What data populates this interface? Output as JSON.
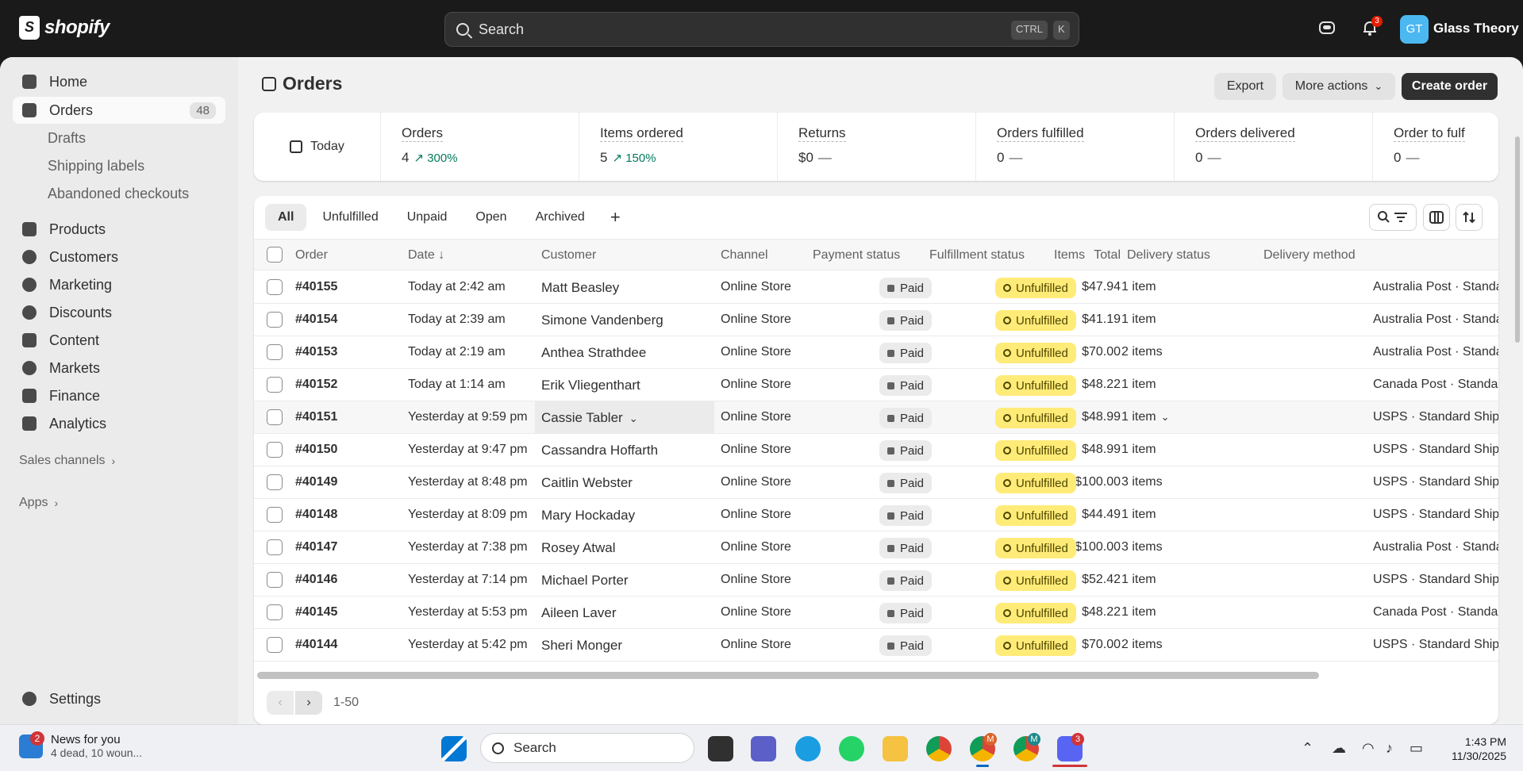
{
  "topbar": {
    "brand": "shopify",
    "search_placeholder": "Search",
    "shortcut_ctrl": "CTRL",
    "shortcut_k": "K",
    "notification_count": "3",
    "avatar_initials": "GT",
    "store_name": "Glass Theory"
  },
  "sidebar": {
    "home": "Home",
    "orders": "Orders",
    "orders_count": "48",
    "drafts": "Drafts",
    "shipping_labels": "Shipping labels",
    "abandoned_checkouts": "Abandoned checkouts",
    "products": "Products",
    "customers": "Customers",
    "marketing": "Marketing",
    "discounts": "Discounts",
    "content": "Content",
    "markets": "Markets",
    "finance": "Finance",
    "analytics": "Analytics",
    "sales_channels": "Sales channels",
    "apps": "Apps",
    "settings": "Settings"
  },
  "header": {
    "title": "Orders",
    "export": "Export",
    "more_actions": "More actions",
    "create_order": "Create order"
  },
  "metrics": {
    "date": "Today",
    "items": [
      {
        "label": "Orders",
        "value": "4",
        "trend": "300%"
      },
      {
        "label": "Items ordered",
        "value": "5",
        "trend": "150%"
      },
      {
        "label": "Returns",
        "value": "$0",
        "trend": "—"
      },
      {
        "label": "Orders fulfilled",
        "value": "0",
        "trend": "—"
      },
      {
        "label": "Orders delivered",
        "value": "0",
        "trend": "—"
      },
      {
        "label": "Order to fulf",
        "value": "0",
        "trend": "—"
      }
    ]
  },
  "tabs": [
    "All",
    "Unfulfilled",
    "Unpaid",
    "Open",
    "Archived",
    "+"
  ],
  "columns": [
    "Order",
    "Date ↓",
    "Customer",
    "Channel",
    "Total",
    "Payment status",
    "Fulfillment status",
    "Items",
    "Delivery status",
    "Delivery method"
  ],
  "rows": [
    {
      "order": "#40155",
      "date": "Today at 2:42 am",
      "customer": "Matt Beasley",
      "channel": "Online Store",
      "total": "$47.94",
      "payment": "Paid",
      "fulfillment": "Unfulfilled",
      "items": "1 item",
      "delivery_method": "Australia Post · Standard Shi..."
    },
    {
      "order": "#40154",
      "date": "Today at 2:39 am",
      "customer": "Simone Vandenberg",
      "channel": "Online Store",
      "total": "$41.19",
      "payment": "Paid",
      "fulfillment": "Unfulfilled",
      "items": "1 item",
      "delivery_method": "Australia Post · Standard Shi..."
    },
    {
      "order": "#40153",
      "date": "Today at 2:19 am",
      "customer": "Anthea Strathdee",
      "channel": "Online Store",
      "total": "$70.00",
      "payment": "Paid",
      "fulfillment": "Unfulfilled",
      "items": "2 items",
      "delivery_method": "Australia Post · Standard Shi..."
    },
    {
      "order": "#40152",
      "date": "Today at 1:14 am",
      "customer": "Erik Vliegenthart",
      "channel": "Online Store",
      "total": "$48.22",
      "payment": "Paid",
      "fulfillment": "Unfulfilled",
      "items": "1 item",
      "delivery_method": "Canada Post · Standard Shipp"
    },
    {
      "order": "#40151",
      "date": "Yesterday at 9:59 pm",
      "customer": "Cassie Tabler",
      "channel": "Online Store",
      "total": "$48.99",
      "payment": "Paid",
      "fulfillment": "Unfulfilled",
      "items": "1 item",
      "delivery_method": "USPS · Standard Shipping"
    },
    {
      "order": "#40150",
      "date": "Yesterday at 9:47 pm",
      "customer": "Cassandra Hoffarth",
      "channel": "Online Store",
      "total": "$48.99",
      "payment": "Paid",
      "fulfillment": "Unfulfilled",
      "items": "1 item",
      "delivery_method": "USPS · Standard Shipping"
    },
    {
      "order": "#40149",
      "date": "Yesterday at 8:48 pm",
      "customer": "Caitlin Webster",
      "channel": "Online Store",
      "total": "$100.00",
      "payment": "Paid",
      "fulfillment": "Unfulfilled",
      "items": "3 items",
      "delivery_method": "USPS · Standard Shipping"
    },
    {
      "order": "#40148",
      "date": "Yesterday at 8:09 pm",
      "customer": "Mary Hockaday",
      "channel": "Online Store",
      "total": "$44.49",
      "payment": "Paid",
      "fulfillment": "Unfulfilled",
      "items": "1 item",
      "delivery_method": "USPS · Standard Shipping"
    },
    {
      "order": "#40147",
      "date": "Yesterday at 7:38 pm",
      "customer": "Rosey Atwal",
      "channel": "Online Store",
      "total": "$100.00",
      "payment": "Paid",
      "fulfillment": "Unfulfilled",
      "items": "3 items",
      "delivery_method": "Australia Post · Standard Shi..."
    },
    {
      "order": "#40146",
      "date": "Yesterday at 7:14 pm",
      "customer": "Michael Porter",
      "channel": "Online Store",
      "total": "$52.42",
      "payment": "Paid",
      "fulfillment": "Unfulfilled",
      "items": "1 item",
      "delivery_method": "USPS · Standard Shipping"
    },
    {
      "order": "#40145",
      "date": "Yesterday at 5:53 pm",
      "customer": "Aileen Laver",
      "channel": "Online Store",
      "total": "$48.22",
      "payment": "Paid",
      "fulfillment": "Unfulfilled",
      "items": "1 item",
      "delivery_method": "Canada Post · Standard Shipp"
    },
    {
      "order": "#40144",
      "date": "Yesterday at 5:42 pm",
      "customer": "Sheri Monger",
      "channel": "Online Store",
      "total": "$70.00",
      "payment": "Paid",
      "fulfillment": "Unfulfilled",
      "items": "2 items",
      "delivery_method": "USPS · Standard Shipping"
    }
  ],
  "pagination": {
    "prev": "‹",
    "next": "›",
    "range": "1-50"
  },
  "taskbar": {
    "news_badge": "2",
    "news_title": "News for you",
    "news_sub": "4 dead, 10 woun...",
    "search": "Search",
    "time": "1:43 PM",
    "date": "11/30/2025",
    "chrome1_badge": "M",
    "chrome2_badge": "M",
    "discord_badge": "3"
  },
  "colors": {
    "accent_dark": "#303030",
    "unfulfilled_bg": "#ffeb78",
    "trend_green": "#047b5d",
    "avatar": "#4bb8f2"
  }
}
